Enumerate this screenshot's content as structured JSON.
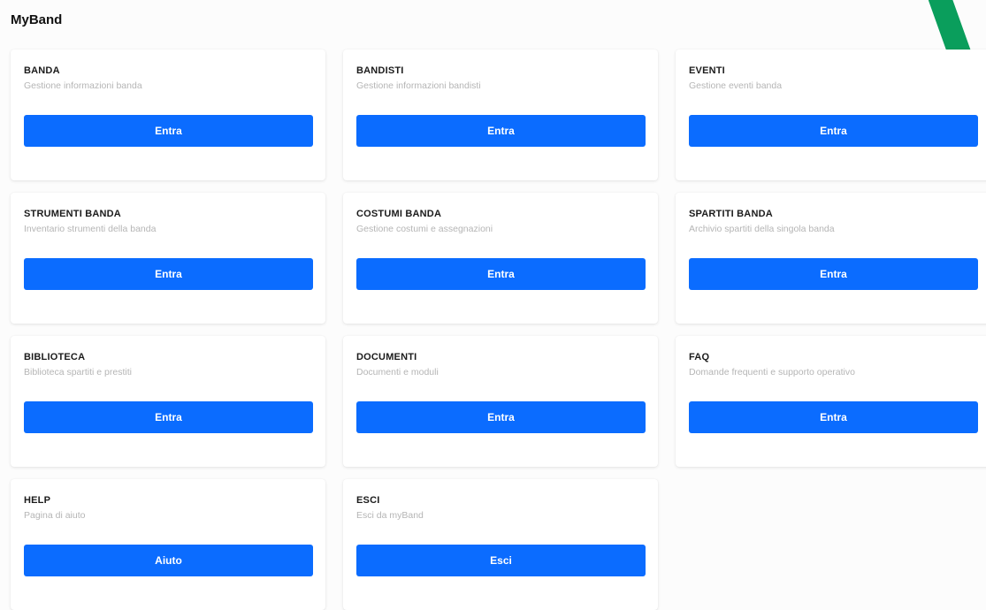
{
  "app": {
    "title": "MyBand"
  },
  "colors": {
    "accent": "#0b6cff",
    "decoration": "#0a9e5c"
  },
  "cards": [
    {
      "title": "BANDA",
      "description": "Gestione informazioni banda",
      "button": "Entra"
    },
    {
      "title": "BANDISTI",
      "description": "Gestione informazioni bandisti",
      "button": "Entra"
    },
    {
      "title": "EVENTI",
      "description": "Gestione eventi banda",
      "button": "Entra"
    },
    {
      "title": "STRUMENTI BANDA",
      "description": "Inventario strumenti della banda",
      "button": "Entra"
    },
    {
      "title": "COSTUMI BANDA",
      "description": "Gestione costumi e assegnazioni",
      "button": "Entra"
    },
    {
      "title": "SPARTITI BANDA",
      "description": "Archivio spartiti della singola banda",
      "button": "Entra"
    },
    {
      "title": "BIBLIOTECA",
      "description": "Biblioteca spartiti e prestiti",
      "button": "Entra"
    },
    {
      "title": "DOCUMENTI",
      "description": "Documenti e moduli",
      "button": "Entra"
    },
    {
      "title": "FAQ",
      "description": "Domande frequenti e supporto operativo",
      "button": "Entra"
    },
    {
      "title": "HELP",
      "description": "Pagina di aiuto",
      "button": "Aiuto"
    },
    {
      "title": "ESCI",
      "description": "Esci da myBand",
      "button": "Esci"
    }
  ]
}
